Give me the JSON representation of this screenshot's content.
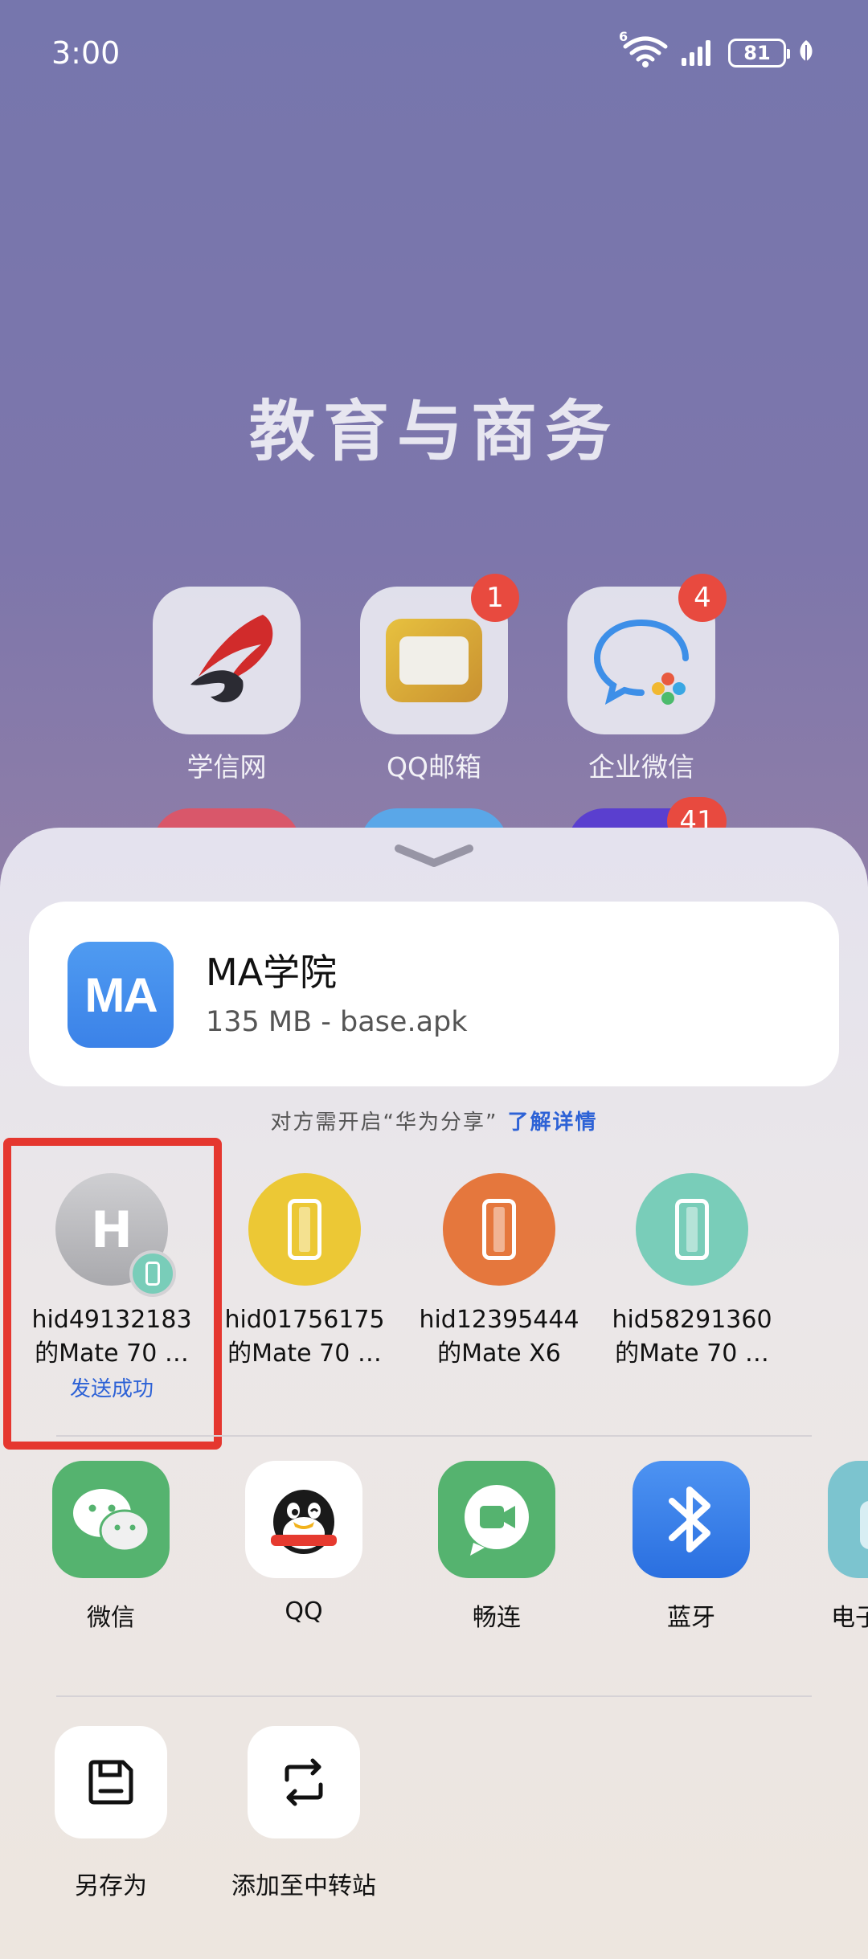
{
  "status_bar": {
    "time": "3:00",
    "network": "6",
    "battery": "81"
  },
  "folder": {
    "title": "教育与商务",
    "apps": [
      {
        "label": "学信网",
        "icon": "xuexin-logo-icon",
        "badge": ""
      },
      {
        "label": "QQ邮箱",
        "icon": "qq-mail-icon",
        "badge": "1"
      },
      {
        "label": "企业微信",
        "icon": "wecom-icon",
        "badge": "4"
      }
    ],
    "peek_badge": "41"
  },
  "share_sheet": {
    "file": {
      "name": "MA学院",
      "meta": "135 MB - base.apk",
      "icon_text": "MA"
    },
    "hint": "对方需开启“华为分享”",
    "hint_link": "了解详情",
    "devices": [
      {
        "avatar_letter": "H",
        "line1": "hid49132183",
        "line2": "的Mate 70 …",
        "status": "发送成功",
        "color": "#c4c4c7"
      },
      {
        "line1": "hid01756175",
        "line2": "的Mate 70 …",
        "status": "",
        "color": "#ecc835"
      },
      {
        "line1": "hid12395444",
        "line2": "的Mate X6",
        "status": "",
        "color": "#e5773d"
      },
      {
        "line1": "hid58291360",
        "line2": "的Mate 70 …",
        "status": "",
        "color": "#79cdb9"
      }
    ],
    "apps": [
      {
        "label": "微信",
        "icon": "wechat-icon"
      },
      {
        "label": "QQ",
        "icon": "qq-icon"
      },
      {
        "label": "畅连",
        "icon": "meetime-icon"
      },
      {
        "label": "蓝牙",
        "icon": "bluetooth-icon"
      },
      {
        "label": "电子",
        "icon": "email-icon"
      }
    ],
    "actions": [
      {
        "label": "另存为",
        "icon": "save-icon"
      },
      {
        "label": "添加至中转站",
        "icon": "transfer-station-icon"
      }
    ]
  },
  "colors": {
    "accent": "#2d62d6",
    "highlight": "#e5372f"
  }
}
